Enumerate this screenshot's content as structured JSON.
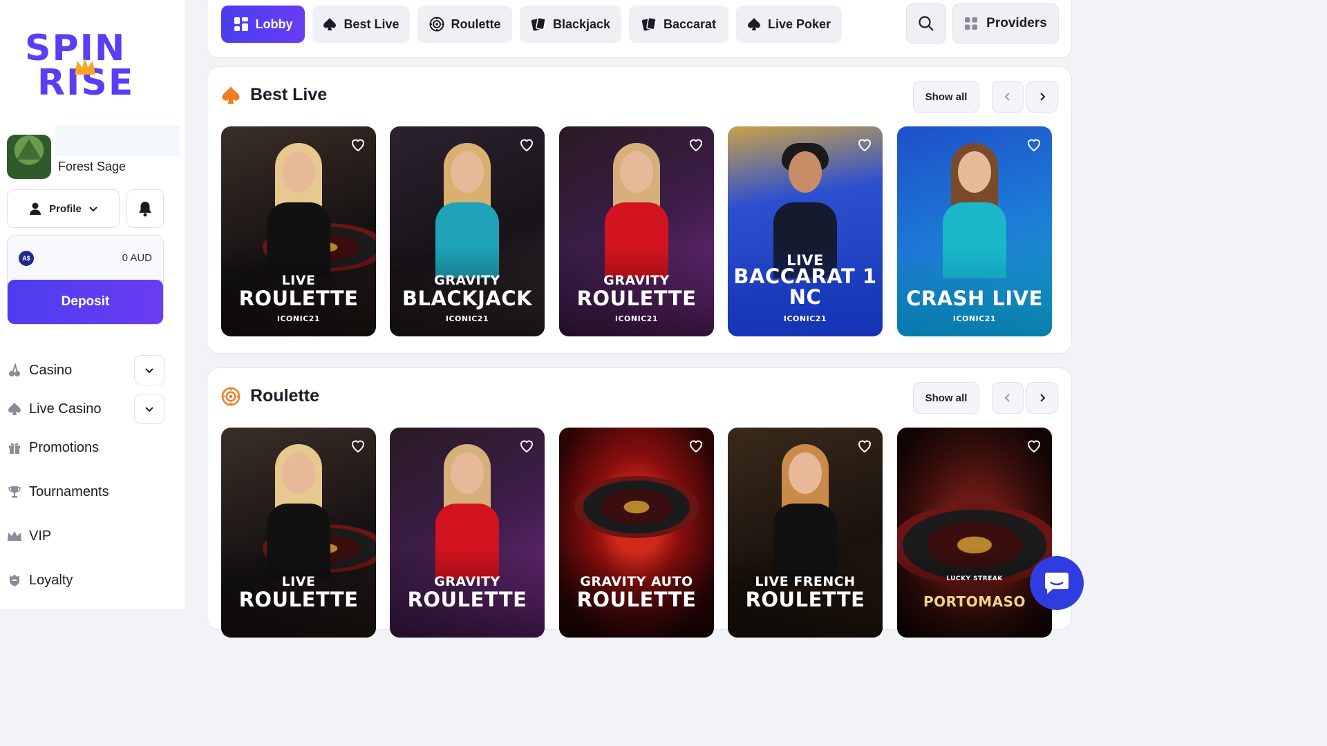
{
  "brand": {
    "line1": "SPIN",
    "line2": "RISE"
  },
  "user": {
    "name": "Forest Sage"
  },
  "profile": {
    "label": "Profile"
  },
  "wallet": {
    "currency_badge": "A$",
    "balance": "0 AUD",
    "deposit_label": "Deposit"
  },
  "nav": {
    "items": [
      {
        "label": "Casino",
        "icon": "cherries-icon",
        "expandable": true
      },
      {
        "label": "Live Casino",
        "icon": "spade-icon",
        "expandable": true
      },
      {
        "label": "Promotions",
        "icon": "gift-icon",
        "expandable": false
      },
      {
        "label": "Tournaments",
        "icon": "trophy-icon",
        "expandable": false
      },
      {
        "label": "VIP",
        "icon": "crown-icon",
        "expandable": false
      },
      {
        "label": "Loyalty",
        "icon": "shield-icon",
        "expandable": false
      }
    ]
  },
  "tabs": [
    {
      "label": "Lobby",
      "icon": "grid-icon",
      "active": true
    },
    {
      "label": "Best Live",
      "icon": "spade-icon",
      "active": false
    },
    {
      "label": "Roulette",
      "icon": "roulette-icon",
      "active": false
    },
    {
      "label": "Blackjack",
      "icon": "cards-icon",
      "active": false
    },
    {
      "label": "Baccarat",
      "icon": "cards-icon",
      "active": false
    },
    {
      "label": "Live Poker",
      "icon": "spade-icon",
      "active": false
    }
  ],
  "providers": {
    "label": "Providers"
  },
  "colors": {
    "accent": "#5a3df5",
    "section_icon": "#f47c20",
    "chat": "#2f3ce0"
  },
  "sections": [
    {
      "title": "Best Live",
      "icon": "spade-icon",
      "show_all": "Show all",
      "cards": [
        {
          "line1": "LIVE",
          "line2": "ROULETTE",
          "line3": "ICONIC21"
        },
        {
          "line1": "GRAVITY",
          "line2": "BLACKJACK",
          "line3": "ICONIC21"
        },
        {
          "line1": "GRAVITY",
          "line2": "ROULETTE",
          "line3": "ICONIC21"
        },
        {
          "line1": "LIVE",
          "line2": "BACCARAT 1 NC",
          "line3": "ICONIC21"
        },
        {
          "line1": "",
          "line2": "CRASH LIVE",
          "line3": "ICONIC21"
        }
      ]
    },
    {
      "title": "Roulette",
      "icon": "roulette-icon",
      "show_all": "Show all",
      "cards": [
        {
          "line1": "LIVE",
          "line2": "ROULETTE",
          "line3": ""
        },
        {
          "line1": "GRAVITY",
          "line2": "ROULETTE",
          "line3": ""
        },
        {
          "line1": "GRAVITY AUTO",
          "line2": "ROULETTE",
          "line3": ""
        },
        {
          "line1": "LIVE FRENCH",
          "line2": "ROULETTE",
          "line3": ""
        },
        {
          "line1": "LUCKY STREAK",
          "line2": "PORTOMASO",
          "line3": ""
        }
      ]
    }
  ]
}
